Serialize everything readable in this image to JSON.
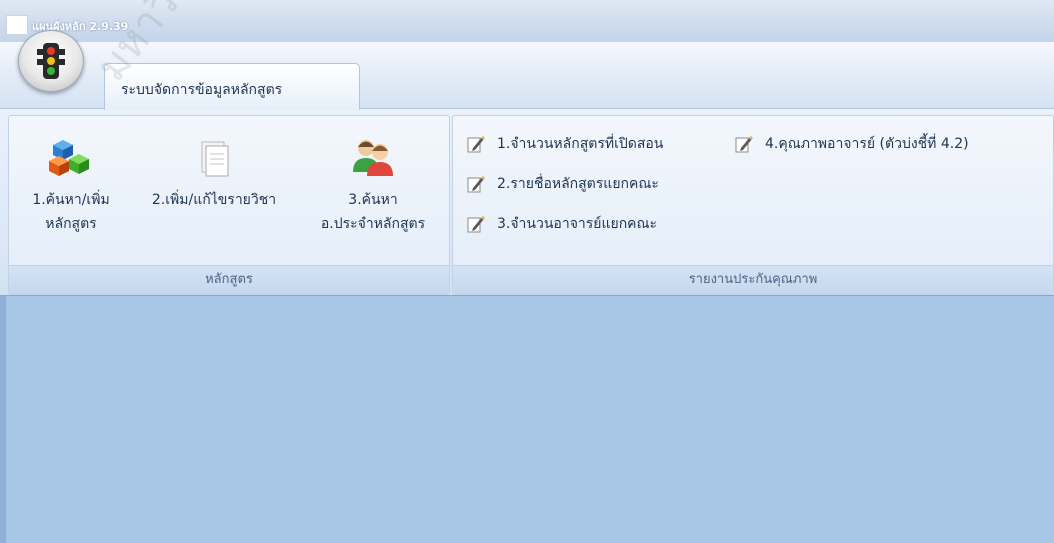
{
  "window": {
    "title": "แผนผังหลัก 2.9.39"
  },
  "tabs": [
    {
      "label": "ระบบจัดการข้อมูลหลักสูตร"
    }
  ],
  "groups": {
    "curriculum": {
      "caption": "หลักสูตร",
      "buttons": [
        {
          "line1": "1.ค้นหา/เพิ่ม",
          "line2": "หลักสูตร",
          "icon": "cubes-icon"
        },
        {
          "line1": "2.เพิ่ม/แก้ไขรายวิชา",
          "line2": "",
          "icon": "document-icon"
        },
        {
          "line1": "3.ค้นหา",
          "line2": "อ.ประจำหลักสูตร",
          "icon": "users-icon"
        }
      ]
    },
    "qa": {
      "caption": "รายงานประกันคุณภาพ",
      "items": [
        {
          "label": "1.จำนวนหลักสูตรที่เปิดสอน",
          "icon": "edit-icon"
        },
        {
          "label": "2.รายชื่อหลักสูตรแยกคณะ",
          "icon": "edit-icon"
        },
        {
          "label": "3.จำนวนอาจารย์แยกคณะ",
          "icon": "edit-icon"
        },
        {
          "label": "4.คุณภาพอาจารย์ (ตัวบ่งชี้ที่ 4.2)",
          "icon": "edit-icon"
        }
      ]
    }
  },
  "watermark": "มหาวิทยาลัยราช",
  "colors": {
    "workspace": "#a7c5e5",
    "ribbon": "#dce8f6",
    "text": "#1f3450"
  }
}
